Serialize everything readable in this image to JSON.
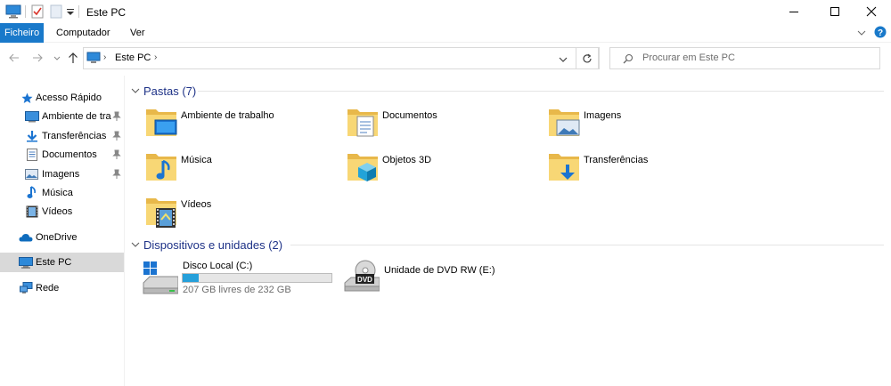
{
  "window": {
    "title": "Este PC",
    "controls": {
      "minimize": "minimize-icon",
      "maximize": "maximize-icon",
      "close": "close-icon"
    }
  },
  "ribbon": {
    "tabs": [
      {
        "label": "Ficheiro",
        "active": true
      },
      {
        "label": "Computador",
        "active": false
      },
      {
        "label": "Ver",
        "active": false
      }
    ]
  },
  "address": {
    "crumbs": [
      "Este PC"
    ],
    "search_placeholder": "Procurar em Este PC"
  },
  "nav": {
    "items": [
      {
        "label": "Acesso Rápido",
        "icon": "star-icon",
        "pinned": false
      },
      {
        "label": "Ambiente de tral",
        "icon": "desktop-icon",
        "pinned": true
      },
      {
        "label": "Transferências",
        "icon": "download-icon",
        "pinned": true
      },
      {
        "label": "Documentos",
        "icon": "documents-icon",
        "pinned": true
      },
      {
        "label": "Imagens",
        "icon": "pictures-icon",
        "pinned": true
      },
      {
        "label": "Música",
        "icon": "music-icon",
        "pinned": false
      },
      {
        "label": "Vídeos",
        "icon": "videos-icon",
        "pinned": false
      },
      {
        "label": "OneDrive",
        "icon": "onedrive-icon",
        "pinned": false
      },
      {
        "label": "Este PC",
        "icon": "computer-icon",
        "pinned": false,
        "selected": true
      },
      {
        "label": "Rede",
        "icon": "network-icon",
        "pinned": false
      }
    ]
  },
  "folders": {
    "heading": "Pastas (7)",
    "items": [
      {
        "label": "Ambiente de trabalho",
        "icon": "desktop-folder-icon"
      },
      {
        "label": "Documentos",
        "icon": "documents-folder-icon"
      },
      {
        "label": "Imagens",
        "icon": "pictures-folder-icon"
      },
      {
        "label": "Música",
        "icon": "music-folder-icon"
      },
      {
        "label": "Objetos 3D",
        "icon": "3d-objects-folder-icon"
      },
      {
        "label": "Transferências",
        "icon": "downloads-folder-icon"
      },
      {
        "label": "Vídeos",
        "icon": "videos-folder-icon"
      }
    ]
  },
  "devices": {
    "heading": "Dispositivos e unidades (2)",
    "items": [
      {
        "label": "Disco Local (C:)",
        "free_text": "207 GB livres de 232 GB",
        "used_fraction": 0.108,
        "icon": "windows-drive-icon"
      },
      {
        "label": "Unidade de DVD RW (E:)",
        "icon": "dvd-drive-icon",
        "badge": "DVD"
      }
    ]
  },
  "colors": {
    "accent": "#1979ca",
    "group_header": "#1e3287",
    "selection": "#d9d9d9",
    "drive_fill": "#26a0da",
    "folder": "#f8d775"
  }
}
